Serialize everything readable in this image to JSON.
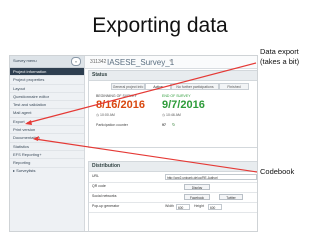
{
  "slide": {
    "title": "Exporting data",
    "annotations": {
      "data_export": [
        "Data export",
        "(takes a bit)"
      ],
      "codebook": "Codebook"
    }
  },
  "sidebar": {
    "header": "Survey menu",
    "collapse_icon": "«",
    "items": [
      {
        "label": "Project information",
        "active": true
      },
      {
        "label": "Project properties",
        "active": false
      },
      {
        "label": "Layout",
        "active": false
      },
      {
        "label": "Questionnaire editor",
        "active": false
      },
      {
        "label": "Test and validation",
        "active": false
      },
      {
        "label": "Mail agent",
        "active": false
      },
      {
        "label": "Export",
        "active": false
      },
      {
        "label": "Print version",
        "active": false
      },
      {
        "label": "Documentation",
        "active": false
      },
      {
        "label": "Statistics",
        "active": false
      },
      {
        "label": "EFS Reporting+",
        "active": false
      },
      {
        "label": "Reporting",
        "active": false
      }
    ],
    "surveys_label": "▸ Surveylists"
  },
  "survey": {
    "id": "311342",
    "name": "IASESE_Survey_1",
    "edit_icon": "✎"
  },
  "status": {
    "header": "Status",
    "tabs": [
      {
        "label": "General project info",
        "selected": false
      },
      {
        "label": "Active",
        "selected": true
      },
      {
        "label": "No further participations",
        "selected": false
      },
      {
        "label": "Finished",
        "selected": false
      }
    ],
    "begin_label": "BEGINNING OF SURVEY",
    "begin_date": "8/16/2016",
    "begin_time": "◷ 10:00 AM",
    "end_label": "END OF SURVEY",
    "end_date": "9/7/2016",
    "end_time": "◷ 10:46 AM",
    "counter_label": "Participation counter",
    "counter_value": "97",
    "counter_icon": "↻"
  },
  "distribution": {
    "header": "Distribution",
    "url_label": "URL",
    "url_value": "http://ww2.unipark.de/uc/RE-Author/",
    "qr_label": "QR code",
    "qr_button": "Display",
    "social_label": "Social networks",
    "facebook": "Facebook",
    "twitter": "Twitter",
    "popup_label": "Pop-up generator",
    "width_label": "Width",
    "width_value": "600",
    "height_label": "Height",
    "height_value": "600"
  },
  "colors": {
    "begin_date": "#d9480f",
    "end_date": "#2e9c3a",
    "arrow": "#e53935",
    "sidebar_active": "#2e3f50"
  }
}
